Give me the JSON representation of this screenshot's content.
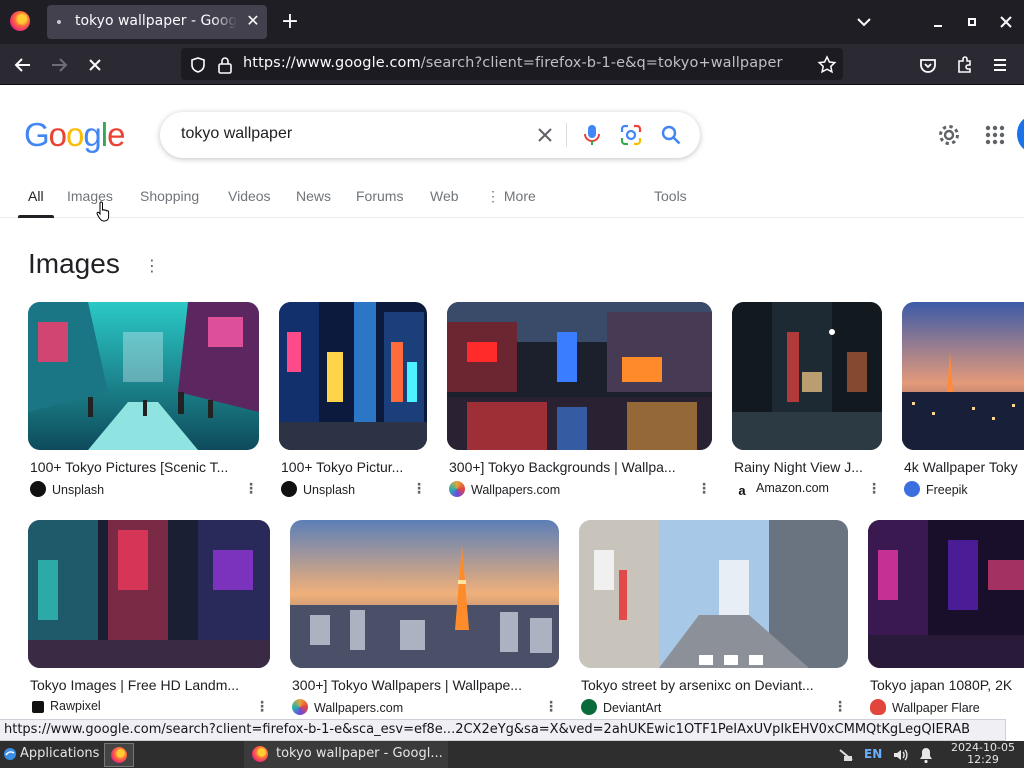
{
  "browser": {
    "tab_title": "tokyo wallpaper - Google Search",
    "tab_close": "✕",
    "new_tab": "+",
    "url_host": "https://www.google.com",
    "url_rest": "/search?client=firefox-b-1-e&q=tokyo+wallpaper",
    "window_controls": {
      "minimize": "▁",
      "maximize": "▫",
      "close": "✕"
    }
  },
  "google": {
    "logo_letters": [
      {
        "ch": "G",
        "color": "#4285f4"
      },
      {
        "ch": "o",
        "color": "#ea4335"
      },
      {
        "ch": "o",
        "color": "#fbbc05"
      },
      {
        "ch": "g",
        "color": "#4285f4"
      },
      {
        "ch": "l",
        "color": "#34a853"
      },
      {
        "ch": "e",
        "color": "#ea4335"
      }
    ],
    "search_query": "tokyo wallpaper",
    "clear_label": "✕",
    "tabs": [
      "All",
      "Images",
      "Shopping",
      "Videos",
      "News",
      "Forums",
      "Web",
      "⋮ More",
      "Tools"
    ],
    "section_heading": "Images",
    "section_menu": "⋮"
  },
  "results_row1": [
    {
      "title": "100+ Tokyo Pictures [Scenic T...",
      "source": "Unsplash",
      "favicon_color": "#111111"
    },
    {
      "title": "100+ Tokyo Pictur...",
      "source": "Unsplash",
      "favicon_color": "#111111"
    },
    {
      "title": "300+] Tokyo Backgrounds | Wallpa...",
      "source": "Wallpapers.com",
      "favicon_color": "#e8a33c"
    },
    {
      "title": "Rainy Night View J...",
      "source": "Amazon.com",
      "favicon_color": "#111111"
    },
    {
      "title": "4k Wallpaper Toky",
      "source": "Freepik",
      "favicon_color": "#3b6fe0"
    }
  ],
  "results_row2": [
    {
      "title": "Tokyo Images | Free HD Landm...",
      "source": "Rawpixel",
      "favicon_color": "#111111"
    },
    {
      "title": "300+] Tokyo Wallpapers | Wallpape...",
      "source": "Wallpapers.com",
      "favicon_color": "#e8a33c"
    },
    {
      "title": "Tokyo street by arsenixc on Deviant...",
      "source": "DeviantArt",
      "favicon_color": "#0a6b3a"
    },
    {
      "title": "Tokyo japan 1080P, 2K",
      "source": "Wallpaper Flare",
      "favicon_color": "#e2453c"
    }
  ],
  "status_url": "https://www.google.com/search?client=firefox-b-1-e&sca_esv=ef8e...2CX2eYg&sa=X&ved=2ahUKEwic1OTF1PeIAxUVpIkEHV0xCMMQtKgLegQIERAB",
  "taskbar": {
    "apps_label": "Applications",
    "window_title": "tokyo wallpaper - Googl...",
    "lang": "EN",
    "date": "2024-10-05",
    "time": "12:29"
  }
}
